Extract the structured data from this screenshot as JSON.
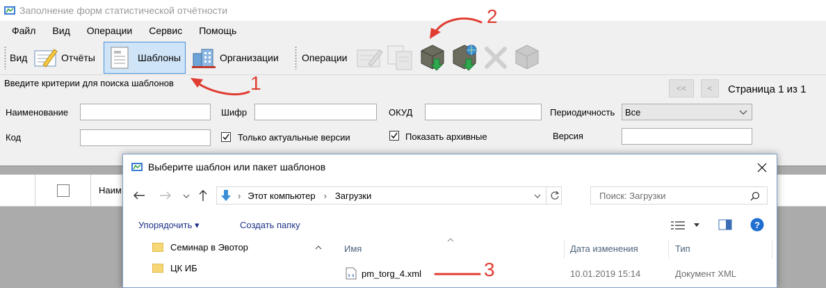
{
  "window": {
    "title": "Заполнение форм статистической отчётности"
  },
  "menu": [
    "Файл",
    "Вид",
    "Операции",
    "Сервис",
    "Помощь"
  ],
  "toolbar": {
    "view_label": "Вид",
    "reports_label": "Отчёты",
    "templates_label": "Шаблоны",
    "orgs_label": "Организации",
    "operations_label": "Операции",
    "icons": [
      "edit-icon",
      "copy-icon",
      "load-template-icon",
      "load-web-template-icon",
      "delete-icon",
      "archive-icon"
    ]
  },
  "search": {
    "hint": "Введите критерии для поиска шаблонов",
    "name_label": "Наименование",
    "code_label": "Шифр",
    "okud_label": "ОКУД",
    "periodicity_label": "Периодичность",
    "periodicity_value": "Все",
    "kod_label": "Код",
    "only_actual_label": "Только актуальные версии",
    "only_actual_checked": true,
    "show_archive_label": "Показать архивные",
    "show_archive_checked": true,
    "version_label": "Версия"
  },
  "pager": {
    "first": "<<",
    "prev": "<",
    "text": "Страница 1 из 1"
  },
  "grid": {
    "name_col": "Наим"
  },
  "dialog": {
    "title": "Выберите шаблон или пакет шаблонов",
    "path": [
      "Этот компьютер",
      "Загрузки"
    ],
    "search_placeholder": "Поиск: Загрузки",
    "organize": "Упорядочить",
    "new_folder": "Создать папку",
    "nav": [
      "Семинар в  Эвотор",
      "ЦК ИБ"
    ],
    "columns": [
      "Имя",
      "Дата изменения",
      "Тип"
    ],
    "file": {
      "name": "pm_torg_4.xml",
      "date": "10.01.2019 15:14",
      "type": "Документ XML"
    }
  },
  "annotations": [
    "1",
    "2",
    "3"
  ],
  "colors": {
    "annotation": "#e03c31",
    "selected": "#cfe4f7",
    "link": "#1e3287"
  }
}
